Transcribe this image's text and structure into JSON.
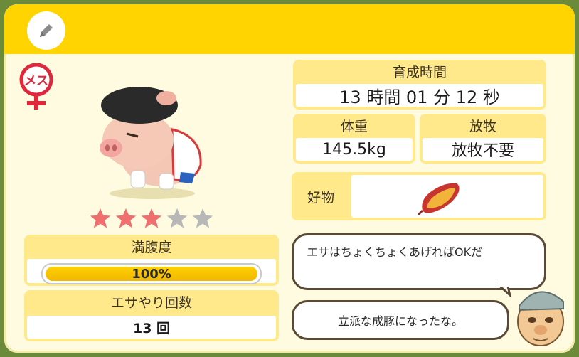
{
  "gender": {
    "label": "メス",
    "color": "#e0283c"
  },
  "rating": {
    "filled": 3,
    "total": 5,
    "filled_color": "#ef6f6f",
    "empty_color": "#b8b8b8"
  },
  "satiety": {
    "label": "満腹度",
    "value_text": "100%",
    "percent": 100
  },
  "feed_count": {
    "label": "エサやり回数",
    "value": "13 回"
  },
  "raise_time": {
    "label": "育成時間",
    "value": "13 時間 01 分 12 秒"
  },
  "weight": {
    "label": "体重",
    "value": "145.5kg"
  },
  "grazing": {
    "label": "放牧",
    "value": "放牧不要"
  },
  "favorite": {
    "label": "好物",
    "item_icon": "sweet-potato-icon"
  },
  "speech": {
    "tip": "エサはちょくちょくあげればOKだ",
    "comment": "立派な成豚になったな。"
  },
  "colors": {
    "header": "#ffd400",
    "panel": "#ffe98a",
    "background": "#fffbe0"
  }
}
